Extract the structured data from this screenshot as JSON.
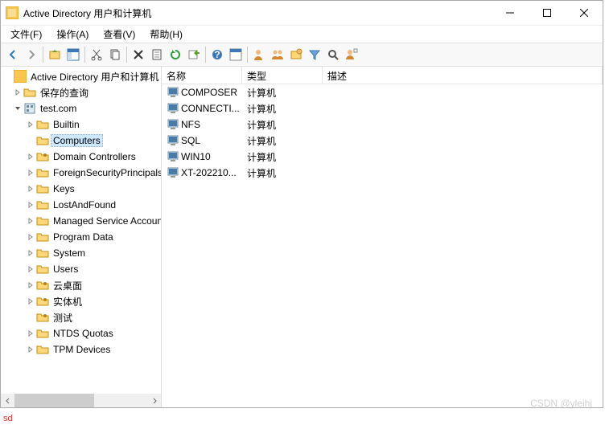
{
  "title": "Active Directory 用户和计算机",
  "menu": {
    "file": "文件(F)",
    "action": "操作(A)",
    "view": "查看(V)",
    "help": "帮助(H)"
  },
  "treeRoot": "Active Directory 用户和计算机",
  "treeSaved": "保存的查询",
  "treeDomain": "test.com",
  "treeNodes": {
    "builtin": "Builtin",
    "computers": "Computers",
    "dc": "Domain Controllers",
    "fsp": "ForeignSecurityPrincipals",
    "keys": "Keys",
    "laf": "LostAndFound",
    "msa": "Managed Service Accounts",
    "pd": "Program Data",
    "sys": "System",
    "users": "Users",
    "ydm": "云桌面",
    "stj": "实体机",
    "cs": "测试",
    "ntds": "NTDS Quotas",
    "tpm": "TPM Devices"
  },
  "cols": {
    "name": "名称",
    "type": "类型",
    "desc": "描述"
  },
  "rows": [
    {
      "name": "COMPOSER",
      "type": "计算机",
      "desc": ""
    },
    {
      "name": "CONNECTI...",
      "type": "计算机",
      "desc": ""
    },
    {
      "name": "NFS",
      "type": "计算机",
      "desc": ""
    },
    {
      "name": "SQL",
      "type": "计算机",
      "desc": ""
    },
    {
      "name": "WIN10",
      "type": "计算机",
      "desc": ""
    },
    {
      "name": "XT-202210...",
      "type": "计算机",
      "desc": ""
    }
  ],
  "watermark": "CSDN @yleihj",
  "sd": "sd"
}
